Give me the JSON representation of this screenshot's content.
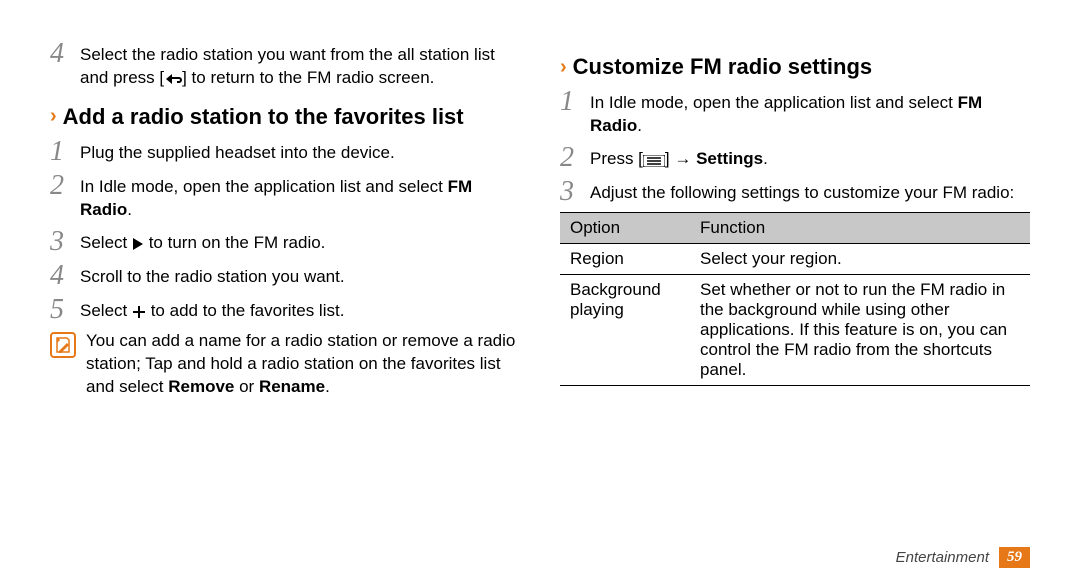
{
  "left": {
    "step4_top": {
      "num": "4",
      "text_a": "Select the radio station you want from the all station list and press [",
      "text_b": "] to return to the FM radio screen."
    },
    "heading": "Add a radio station to the favorites list",
    "steps": [
      {
        "num": "1",
        "text": "Plug the supplied headset into the device."
      },
      {
        "num": "2",
        "text_a": "In Idle mode, open the application list and select ",
        "bold": "FM Radio",
        "text_b": "."
      },
      {
        "num": "3",
        "text_a": "Select ",
        "text_b": " to turn on the FM radio."
      },
      {
        "num": "4",
        "text": "Scroll to the radio station you want."
      },
      {
        "num": "5",
        "text_a": "Select ",
        "text_b": " to add to the favorites list."
      }
    ],
    "note": {
      "text_a": "You can add a name for a radio station or remove a radio station; Tap and hold a radio station on the favorites list and select ",
      "bold1": "Remove",
      "or": " or ",
      "bold2": "Rename",
      "text_b": "."
    }
  },
  "right": {
    "heading": "Customize FM radio settings",
    "steps": [
      {
        "num": "1",
        "text_a": "In Idle mode, open the application list and select ",
        "bold": "FM Radio",
        "text_b": "."
      },
      {
        "num": "2",
        "text_a": "Press [",
        "text_b": "] → ",
        "bold": "Settings",
        "text_c": "."
      },
      {
        "num": "3",
        "text": "Adjust the following settings to customize your FM radio:"
      }
    ],
    "table": {
      "head": {
        "c1": "Option",
        "c2": "Function"
      },
      "rows": [
        {
          "c1": "Region",
          "c2": "Select your region."
        },
        {
          "c1": "Background playing",
          "c2": "Set whether or not to run the FM radio in the background while using other applications. If this feature is on, you can control the FM radio from the shortcuts panel."
        }
      ]
    }
  },
  "footer": {
    "section": "Entertainment",
    "page": "59"
  },
  "chart_data": {
    "type": "table",
    "title": "FM radio settings options",
    "columns": [
      "Option",
      "Function"
    ],
    "rows": [
      [
        "Region",
        "Select your region."
      ],
      [
        "Background playing",
        "Set whether or not to run the FM radio in the background while using other applications. If this feature is on, you can control the FM radio from the shortcuts panel."
      ]
    ]
  }
}
